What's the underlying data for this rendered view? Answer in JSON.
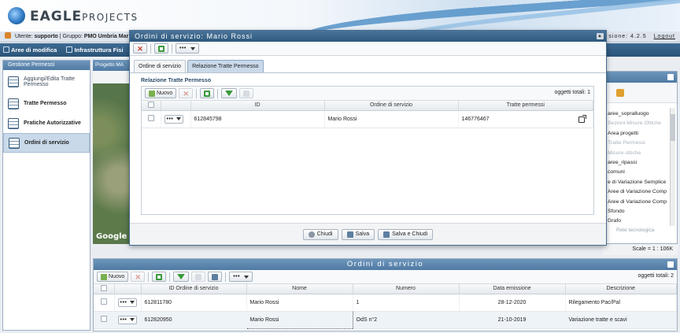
{
  "brand": {
    "logo_main": "EAGLE",
    "logo_sub": "PROJECTS"
  },
  "userbar": {
    "user_label": "Utente:",
    "user": "supporto",
    "group_label": "| Gruppo:",
    "group": "PMO Umbria Mar",
    "version": "sione: 4.2.5",
    "logout": "Logout"
  },
  "menubar": {
    "items": [
      "Aree di modifica",
      "Infrastruttura Fisi"
    ]
  },
  "left_panel": {
    "title": "Gestione Permessi",
    "items": [
      {
        "label": "Aggiungi/Edita Tratte Permesso"
      },
      {
        "label": "Tratte Permesso"
      },
      {
        "label": "Pratiche Autorizzative"
      },
      {
        "label": "Ordini di servizio"
      }
    ]
  },
  "map": {
    "title": "Progetto MA",
    "google": "Google"
  },
  "layers": {
    "items": [
      {
        "label": "aree_sopralluogo",
        "dim": false
      },
      {
        "label": "Sezioni Misure Ottiche",
        "dim": true
      },
      {
        "label": "Area progetti",
        "dim": false
      },
      {
        "label": "Tratte Permessi",
        "dim": true
      },
      {
        "label": "Misure ottiche",
        "dim": true
      },
      {
        "label": "aree_ripassi",
        "dim": false
      },
      {
        "label": "comuni",
        "dim": false
      },
      {
        "label": "e di Variazione Semplice",
        "dim": false
      },
      {
        "label": "Aree di Variazione Comp",
        "dim": false
      },
      {
        "label": "Aree di Variazione Comp",
        "dim": false
      },
      {
        "label": "Sfondo",
        "dim": false
      },
      {
        "label": "Grafo",
        "dim": false
      }
    ],
    "rete": "Rete tecnologica",
    "scale": "Scale = 1 : 106K"
  },
  "bottom": {
    "title": "Ordini di servizio",
    "new_label": "Nuovo",
    "more_label": "•••",
    "count": "oggetti totali: 2",
    "columns": [
      "ID Ordine di servizio",
      "Nome",
      "Numero",
      "Data emissione",
      "Descrizione"
    ],
    "rows": [
      {
        "id": "612811780",
        "nome": "Mario Rossi",
        "numero": "1",
        "data": "28-12-2020",
        "descrizione": "Rilegamento Pac/Pal"
      },
      {
        "id": "612820950",
        "nome": "Mario Rossi",
        "numero": "OdS n°2",
        "data": "21-10-2019",
        "descrizione": "Variazione tratte e scavi"
      }
    ]
  },
  "modal": {
    "title": "Ordini di servizio: Mario Rossi",
    "more_label": "•••",
    "tabs": [
      "Ordine di servizio",
      "Relazione Tratte Permesso"
    ],
    "section_title": "Relazione Tratte Permesso",
    "new_label": "Nuovo",
    "count": "oggetti totali: 1",
    "columns": [
      "ID",
      "Ordine di servizio",
      "Tratte permessi"
    ],
    "rows": [
      {
        "id": "612845798",
        "ordine": "Mario Rossi",
        "tratte": "146776467"
      }
    ],
    "buttons": {
      "close": "Chiudi",
      "save": "Salva",
      "save_close": "Salva e Chiudi"
    }
  }
}
